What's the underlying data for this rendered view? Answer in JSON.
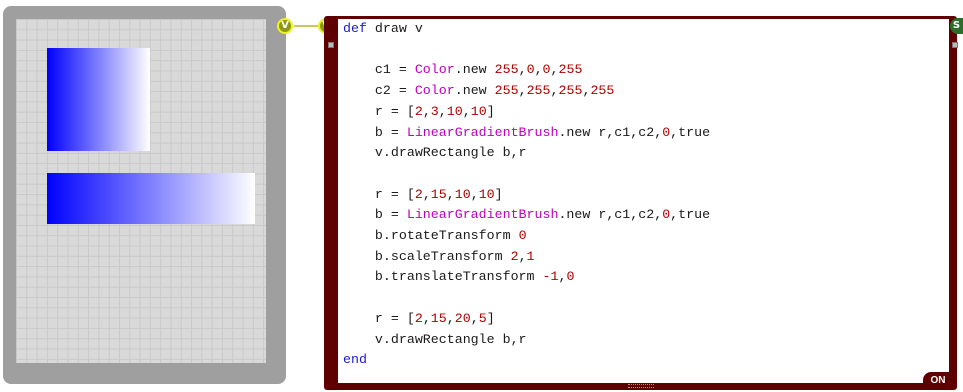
{
  "canvas": {
    "rectangles": [
      {
        "from": "#0000ff",
        "to": "#ffffff"
      },
      {
        "from": "#0000ff",
        "to": "#ffffff"
      }
    ]
  },
  "badges": {
    "output_letter": "V",
    "input_letter": "V",
    "side_letter": "S"
  },
  "code": {
    "lines": [
      [
        [
          "kw",
          "def"
        ],
        [
          "t",
          " draw v"
        ]
      ],
      [],
      [
        [
          "t",
          "    c1 = "
        ],
        [
          "cls",
          "Color"
        ],
        [
          "t",
          ".new "
        ],
        [
          "num",
          "255"
        ],
        [
          "t",
          ","
        ],
        [
          "num",
          "0"
        ],
        [
          "t",
          ","
        ],
        [
          "num",
          "0"
        ],
        [
          "t",
          ","
        ],
        [
          "num",
          "255"
        ]
      ],
      [
        [
          "t",
          "    c2 = "
        ],
        [
          "cls",
          "Color"
        ],
        [
          "t",
          ".new "
        ],
        [
          "num",
          "255"
        ],
        [
          "t",
          ","
        ],
        [
          "num",
          "255"
        ],
        [
          "t",
          ","
        ],
        [
          "num",
          "255"
        ],
        [
          "t",
          ","
        ],
        [
          "num",
          "255"
        ]
      ],
      [
        [
          "t",
          "    r = ["
        ],
        [
          "num",
          "2"
        ],
        [
          "t",
          ","
        ],
        [
          "num",
          "3"
        ],
        [
          "t",
          ","
        ],
        [
          "num",
          "10"
        ],
        [
          "t",
          ","
        ],
        [
          "num",
          "10"
        ],
        [
          "t",
          "]"
        ]
      ],
      [
        [
          "t",
          "    b = "
        ],
        [
          "cls",
          "LinearGradientBrush"
        ],
        [
          "t",
          ".new r,c1,c2,"
        ],
        [
          "num",
          "0"
        ],
        [
          "t",
          ",true"
        ]
      ],
      [
        [
          "t",
          "    v.drawRectangle b,r"
        ]
      ],
      [],
      [
        [
          "t",
          "    r = ["
        ],
        [
          "num",
          "2"
        ],
        [
          "t",
          ","
        ],
        [
          "num",
          "15"
        ],
        [
          "t",
          ","
        ],
        [
          "num",
          "10"
        ],
        [
          "t",
          ","
        ],
        [
          "num",
          "10"
        ],
        [
          "t",
          "]"
        ]
      ],
      [
        [
          "t",
          "    b = "
        ],
        [
          "cls",
          "LinearGradientBrush"
        ],
        [
          "t",
          ".new r,c1,c2,"
        ],
        [
          "num",
          "0"
        ],
        [
          "t",
          ",true"
        ]
      ],
      [
        [
          "t",
          "    b.rotateTransform "
        ],
        [
          "num",
          "0"
        ]
      ],
      [
        [
          "t",
          "    b.scaleTransform "
        ],
        [
          "num",
          "2"
        ],
        [
          "t",
          ","
        ],
        [
          "num",
          "1"
        ]
      ],
      [
        [
          "t",
          "    b.translateTransform "
        ],
        [
          "num",
          "-1"
        ],
        [
          "t",
          ","
        ],
        [
          "num",
          "0"
        ]
      ],
      [],
      [
        [
          "t",
          "    r = ["
        ],
        [
          "num",
          "2"
        ],
        [
          "t",
          ","
        ],
        [
          "num",
          "15"
        ],
        [
          "t",
          ","
        ],
        [
          "num",
          "20"
        ],
        [
          "t",
          ","
        ],
        [
          "num",
          "5"
        ],
        [
          "t",
          "]"
        ]
      ],
      [
        [
          "t",
          "    v.drawRectangle b,r"
        ]
      ],
      [
        [
          "kw",
          "end"
        ]
      ]
    ]
  },
  "status": {
    "toggle_label": "ON"
  },
  "colors": {
    "panel_border": "#5e0000",
    "keyword": "#1a1ad0",
    "class": "#c000c0",
    "number": "#b00000"
  }
}
